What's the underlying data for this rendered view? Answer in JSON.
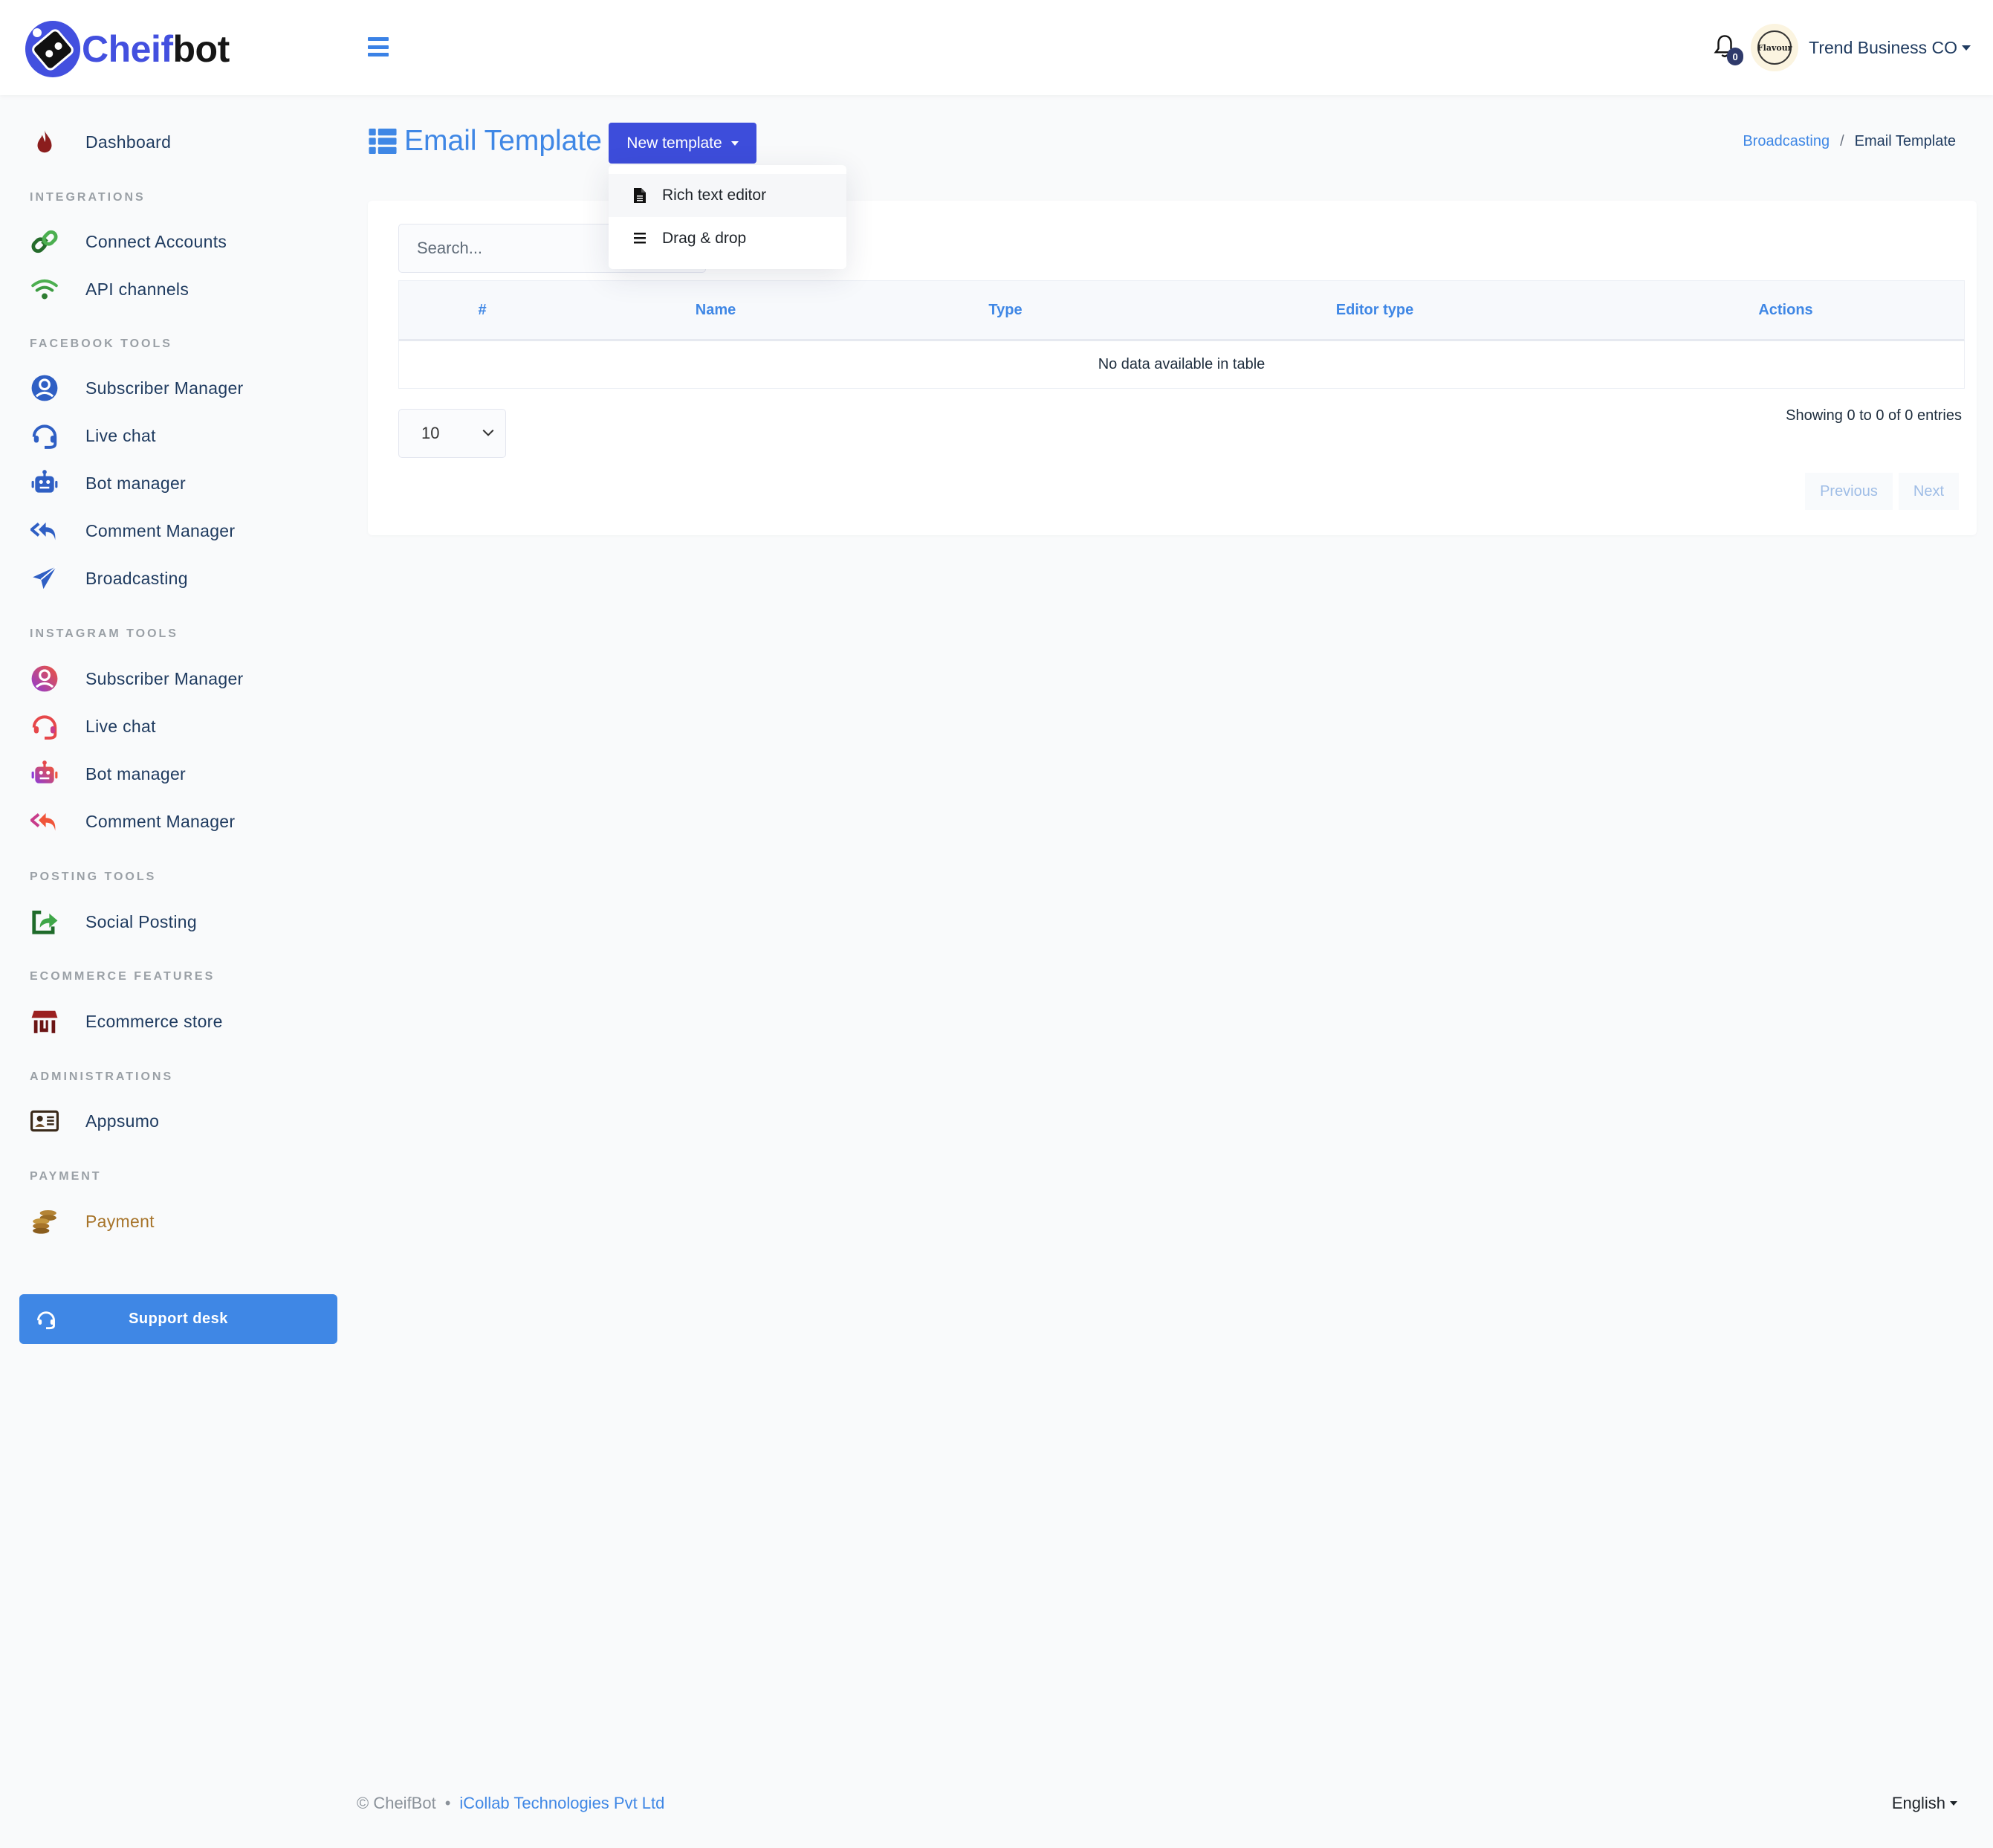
{
  "brand": {
    "name_part1": "Cheif",
    "name_part2": "bot",
    "color_primary": "#4350df"
  },
  "header": {
    "notification_count": "0",
    "avatar_text": "Flavour",
    "user_name": "Trend Business CO"
  },
  "sidebar": {
    "items": [
      {
        "label": "Dashboard",
        "icon": "fire-icon"
      },
      {
        "section": "Integrations"
      },
      {
        "label": "Connect Accounts",
        "icon": "link-icon"
      },
      {
        "label": "API channels",
        "icon": "wifi-icon"
      },
      {
        "section": "Facebook Tools"
      },
      {
        "label": "Subscriber Manager",
        "icon": "user-circle-icon"
      },
      {
        "label": "Live chat",
        "icon": "headset-icon"
      },
      {
        "label": "Bot manager",
        "icon": "robot-icon"
      },
      {
        "label": "Comment Manager",
        "icon": "reply-all-icon"
      },
      {
        "label": "Broadcasting",
        "icon": "paper-plane-icon"
      },
      {
        "section": "Instagram Tools"
      },
      {
        "label": "Subscriber Manager",
        "icon": "user-circle-icon"
      },
      {
        "label": "Live chat",
        "icon": "headset-icon"
      },
      {
        "label": "Bot manager",
        "icon": "robot-icon"
      },
      {
        "label": "Comment Manager",
        "icon": "reply-all-icon"
      },
      {
        "section": "Posting Tools"
      },
      {
        "label": "Social Posting",
        "icon": "share-square-icon"
      },
      {
        "section": "Ecommerce Features"
      },
      {
        "label": "Ecommerce store",
        "icon": "store-icon"
      },
      {
        "section": "Administrations"
      },
      {
        "label": "Appsumo",
        "icon": "id-card-icon"
      },
      {
        "section": "Payment"
      },
      {
        "label": "Payment",
        "icon": "coins-icon"
      }
    ],
    "support_label": "Support desk"
  },
  "page": {
    "title": "Email Template",
    "new_button_label": "New template",
    "dropdown": [
      {
        "label": "Rich text editor",
        "icon": "file-text-icon"
      },
      {
        "label": "Drag & drop",
        "icon": "bars-icon"
      }
    ],
    "breadcrumb": {
      "parent": "Broadcasting",
      "separator": "/",
      "current": "Email Template"
    }
  },
  "table": {
    "search_placeholder": "Search...",
    "columns": [
      "#",
      "Name",
      "Type",
      "Editor type",
      "Actions"
    ],
    "empty_message": "No data available in table",
    "page_length": "10",
    "info": "Showing 0 to 0 of 0 entries",
    "prev_label": "Previous",
    "next_label": "Next"
  },
  "footer": {
    "copyright": "© CheifBot",
    "separator": "•",
    "company_link": "iCollab Technologies Pvt Ltd",
    "language": "English"
  }
}
